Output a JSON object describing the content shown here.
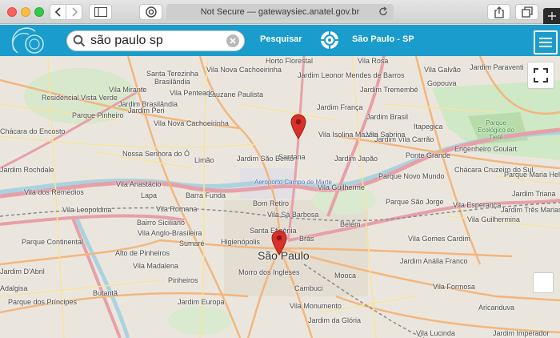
{
  "browser": {
    "url_text": "Not Secure — gatewaysiec.anatel.gov.br",
    "icons": [
      "back-icon",
      "forward-icon",
      "sidebar-icon",
      "privacy-icon",
      "reload-icon",
      "share-icon",
      "tabs-icon",
      "new-tab-icon"
    ]
  },
  "toolbar": {
    "search_value": "são paulo sp",
    "search_button": "Pesquisar",
    "location_label": "São Paulo - SP",
    "colors": {
      "bar": "#1a9ccc",
      "text": "#ffffff"
    }
  },
  "map": {
    "labels": [
      "Horto Florestal",
      "Vila Nova Cachoeirinha",
      "Vila Rosa",
      "Vila Galvão",
      "Jardim Paraventi",
      "Santa Terezinha",
      "Lauzane Paulista",
      "Jardim Leonor Mendes de Barros",
      "Jardim Tremembé",
      "Gopouva",
      "Jardim França",
      "Brasilândia",
      "Vila Mirante",
      "Vila Penteado",
      "Jardim Brasilândia",
      "Residencial Vista Verde",
      "Jardim Peri",
      "Parque Pinheiro",
      "Chácara do Encosto",
      "Vila Nova Cachoeirinha",
      "Jardim Brasil",
      "Itapegica",
      "Jardim Japão",
      "Jardim Vila Carrão",
      "Ponte Grande",
      "Engenheiro Goulart",
      "Jardim Rochdale",
      "Nossa Senhora do Ó",
      "Limão",
      "Jardim São Bento",
      "Santana",
      "Vila Isolina Mazzei",
      "Vila Sabrina",
      "Parque Novo Mundo",
      "Chácara Cruzeiro do Sul",
      "Parque Maria Helena",
      "Vila dos Remédios",
      "Vila Anastácio",
      "Lapa",
      "Barra Funda",
      "Aeroporto Campo de Marte",
      "Vila Guilherme",
      "Jardim Triana",
      "Vila Leopoldina",
      "Vila Romana",
      "Bom Retiro",
      "Vila Sá Barbosa",
      "Parque São Jorge",
      "Vila Esperança",
      "Jardim Três Marias",
      "Bairro Siciliano",
      "Vila Anglo-Brasileira",
      "Belém",
      "Vila Guilhermina",
      "Parque Continental",
      "Sumaré",
      "Higienópolis",
      "Santa Efigênia",
      "Brás",
      "São Paulo",
      "Vila Gomes Cardim",
      "Alto de Pinheiros",
      "Vila Madalena",
      "Jardim Anália Franco",
      "Jardim D'Abril",
      "Pinheiros",
      "Morro dos Ingleses",
      "Mooca",
      "Vila Formosa",
      "Adalgisa",
      "Butantã",
      "Jardim Europa",
      "Cambuci",
      "Vila Monumento",
      "Parque dos Príncipes",
      "Jardim da Glória",
      "Aricanduva",
      "Jardim Imperador",
      "Vila Lucinda",
      "Parque Ecológico do Tietê"
    ],
    "markers": [
      "map-marker-santana",
      "map-marker-sao-paulo"
    ],
    "colors": {
      "water": "#aad3df",
      "park": "#c8e6c0",
      "primary_road": "#f2b67e",
      "highway": "#e6a0a8",
      "rail": "#8a8a8a"
    }
  }
}
